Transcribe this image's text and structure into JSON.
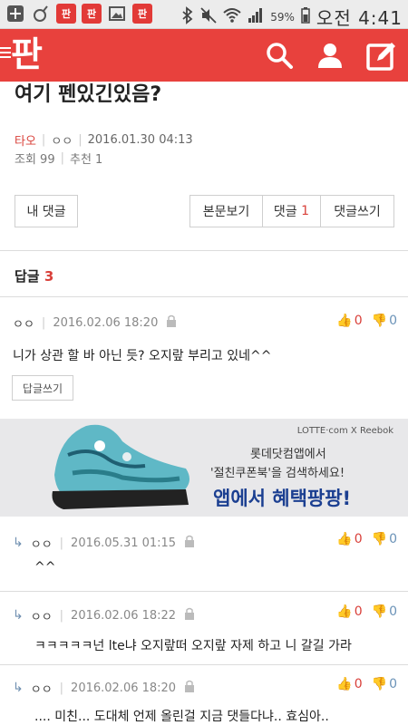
{
  "statusbar": {
    "battery_pct": "59%",
    "time": "오전 4:41",
    "app_badge": "판"
  },
  "header": {
    "logo": "판"
  },
  "post": {
    "title": "여기 펜있긴있음?",
    "author": "타오",
    "nickname": "ㅇㅇ",
    "datetime": "2016.01.30 04:13",
    "views": "조회 99",
    "recommend": "추천 1"
  },
  "buttons": {
    "my_comments": "내 댓글",
    "view_post": "본문보기",
    "comments_label": "댓글",
    "comments_count": "1",
    "write_comment": "댓글쓰기"
  },
  "replies": {
    "heading": "답글",
    "count": "3"
  },
  "comments": [
    {
      "author": "ㅇㅇ",
      "date": "2016.02.06 18:20",
      "text": "니가 상관 할 바 아닌 듯? 오지랖 부리고 있네^^",
      "up": "0",
      "down": "0",
      "reply_label": "답글쓰기"
    },
    {
      "author": "ㅇㅇ",
      "date": "2016.05.31 01:15",
      "text": "^^",
      "up": "0",
      "down": "0"
    },
    {
      "author": "ㅇㅇ",
      "date": "2016.02.06 18:22",
      "text": "ㅋㅋㅋㅋㅋ넌 lte냐 오지랖떠 오지랖 자제 하고 니 갈길 가라",
      "up": "0",
      "down": "0"
    },
    {
      "author": "ㅇㅇ",
      "date": "2016.02.06 18:20",
      "text": ".... 미친... 도대체 언제 올린걸 지금 댓들다냐.. 효심아..",
      "up": "0",
      "down": "0"
    }
  ],
  "ad": {
    "brand": "LOTTE·com X Reebok",
    "line1": "롯데닷컴앱에서",
    "line2": "'절친쿠폰북'을 검색하세요!",
    "line3": "앱에서 혜택팡팡!"
  },
  "colors": {
    "brand_red": "#e8413d",
    "accent_red": "#d9403a",
    "down_blue": "#6b93b8"
  }
}
